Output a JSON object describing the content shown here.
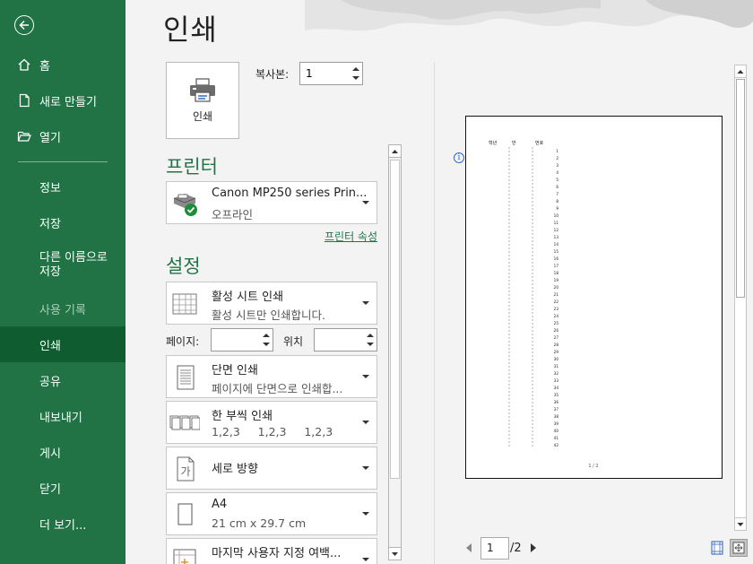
{
  "nav": {
    "items": [
      {
        "label": "홈",
        "icon": "home-icon"
      },
      {
        "label": "새로 만들기",
        "icon": "new-file-icon"
      },
      {
        "label": "열기",
        "icon": "open-folder-icon"
      },
      {
        "label": "정보"
      },
      {
        "label": "저장"
      },
      {
        "label": "다른 이름으로\n저장"
      },
      {
        "label": "사용 기록",
        "state": "disabled"
      },
      {
        "label": "인쇄",
        "state": "active"
      },
      {
        "label": "공유"
      },
      {
        "label": "내보내기"
      },
      {
        "label": "게시"
      },
      {
        "label": "닫기"
      },
      {
        "label": "더 보기..."
      }
    ]
  },
  "header": {
    "title": "인쇄"
  },
  "print": {
    "button_label": "인쇄",
    "copies_label": "복사본:",
    "copies_value": "1"
  },
  "printer": {
    "section_title": "프린터",
    "name": "Canon MP250 series Prin...",
    "status": "오프라인",
    "properties_link": "프린터 속성"
  },
  "settings": {
    "section_title": "설정",
    "scope": {
      "title": "활성 시트 인쇄",
      "desc": "활성 시트만 인쇄합니다."
    },
    "pages_label": "페이지:",
    "to_label": "위치",
    "pages_from": "",
    "pages_to": "",
    "sides": {
      "title": "단면 인쇄",
      "desc": "페이지에 단면으로 인쇄합..."
    },
    "collate": {
      "title": "한 부씩 인쇄",
      "desc": "1,2,3     1,2,3     1,2,3"
    },
    "orientation": {
      "title": "세로 방향"
    },
    "paper": {
      "title": "A4",
      "desc": "21 cm x 29.7 cm"
    },
    "margins": {
      "title": "마지막 사용자 지정 여백..."
    }
  },
  "preview": {
    "col_headers": [
      "학년",
      "반",
      "번호"
    ],
    "row_numbers": [
      "1",
      "2",
      "3",
      "4",
      "5",
      "6",
      "7",
      "8",
      "9",
      "10",
      "11",
      "12",
      "13",
      "14",
      "15",
      "16",
      "17",
      "18",
      "19",
      "20",
      "21",
      "22",
      "23",
      "24",
      "25",
      "26",
      "27",
      "28",
      "29",
      "30",
      "31",
      "32",
      "33",
      "34",
      "35",
      "36",
      "37",
      "38",
      "39",
      "40",
      "41",
      "42"
    ],
    "footer": "1 / 2",
    "current_page": "1",
    "total_pages": "/2"
  },
  "colors": {
    "accent": "#217346",
    "nav_active": "#0e5c2f"
  }
}
